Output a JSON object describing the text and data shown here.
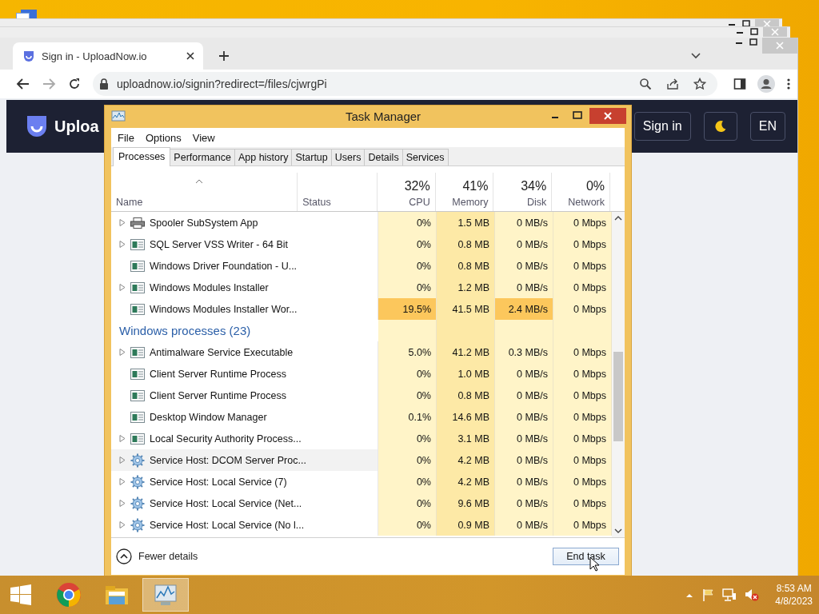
{
  "browser": {
    "tab": {
      "title": "Sign in - UploadNow.io"
    },
    "url": "uploadnow.io/signin?redirect=/files/cjwrgPi",
    "page": {
      "brand": "Uploa",
      "sign_in": "Sign in",
      "language": "EN"
    }
  },
  "task_manager": {
    "title": "Task Manager",
    "menu": [
      "File",
      "Options",
      "View"
    ],
    "tabs": [
      {
        "label": "Processes",
        "selected": true
      },
      {
        "label": "Performance",
        "selected": false
      },
      {
        "label": "App history",
        "selected": false
      },
      {
        "label": "Startup",
        "selected": false
      },
      {
        "label": "Users",
        "selected": false
      },
      {
        "label": "Details",
        "selected": false
      },
      {
        "label": "Services",
        "selected": false
      }
    ],
    "columns": [
      {
        "label": "Name"
      },
      {
        "label": "Status"
      },
      {
        "usage": "32%",
        "label": "CPU"
      },
      {
        "usage": "41%",
        "label": "Memory"
      },
      {
        "usage": "34%",
        "label": "Disk"
      },
      {
        "usage": "0%",
        "label": "Network"
      }
    ],
    "rows": [
      {
        "kind": "printer",
        "name": "Spooler SubSystem App",
        "expandable": true,
        "selected": false,
        "cells": [
          {
            "value": "0%",
            "hot": false
          },
          {
            "value": "1.5 MB",
            "hot": false
          },
          {
            "value": "0 MB/s",
            "hot": false
          },
          {
            "value": "0 Mbps",
            "hot": false
          }
        ]
      },
      {
        "kind": "app",
        "name": "SQL Server VSS Writer - 64 Bit",
        "expandable": true,
        "selected": false,
        "cells": [
          {
            "value": "0%",
            "hot": false
          },
          {
            "value": "0.8 MB",
            "hot": false
          },
          {
            "value": "0 MB/s",
            "hot": false
          },
          {
            "value": "0 Mbps",
            "hot": false
          }
        ]
      },
      {
        "kind": "app",
        "name": "Windows Driver Foundation - U...",
        "expandable": false,
        "selected": false,
        "cells": [
          {
            "value": "0%",
            "hot": false
          },
          {
            "value": "0.8 MB",
            "hot": false
          },
          {
            "value": "0 MB/s",
            "hot": false
          },
          {
            "value": "0 Mbps",
            "hot": false
          }
        ]
      },
      {
        "kind": "app",
        "name": "Windows Modules Installer",
        "expandable": true,
        "selected": false,
        "cells": [
          {
            "value": "0%",
            "hot": false
          },
          {
            "value": "1.2 MB",
            "hot": false
          },
          {
            "value": "0 MB/s",
            "hot": false
          },
          {
            "value": "0 Mbps",
            "hot": false
          }
        ]
      },
      {
        "kind": "app",
        "name": "Windows Modules Installer Wor...",
        "expandable": false,
        "selected": false,
        "cells": [
          {
            "value": "19.5%",
            "hot": true
          },
          {
            "value": "41.5 MB",
            "hot": false
          },
          {
            "value": "2.4 MB/s",
            "hot": true
          },
          {
            "value": "0 Mbps",
            "hot": false
          }
        ]
      },
      {
        "kind": "group",
        "name": "Windows processes (23)"
      },
      {
        "kind": "app",
        "name": "Antimalware Service Executable",
        "expandable": true,
        "selected": false,
        "cells": [
          {
            "value": "5.0%",
            "hot": false
          },
          {
            "value": "41.2 MB",
            "hot": false
          },
          {
            "value": "0.3 MB/s",
            "hot": false
          },
          {
            "value": "0 Mbps",
            "hot": false
          }
        ]
      },
      {
        "kind": "app",
        "name": "Client Server Runtime Process",
        "expandable": false,
        "selected": false,
        "cells": [
          {
            "value": "0%",
            "hot": false
          },
          {
            "value": "1.0 MB",
            "hot": false
          },
          {
            "value": "0 MB/s",
            "hot": false
          },
          {
            "value": "0 Mbps",
            "hot": false
          }
        ]
      },
      {
        "kind": "app",
        "name": "Client Server Runtime Process",
        "expandable": false,
        "selected": false,
        "cells": [
          {
            "value": "0%",
            "hot": false
          },
          {
            "value": "0.8 MB",
            "hot": false
          },
          {
            "value": "0 MB/s",
            "hot": false
          },
          {
            "value": "0 Mbps",
            "hot": false
          }
        ]
      },
      {
        "kind": "app",
        "name": "Desktop Window Manager",
        "expandable": false,
        "selected": false,
        "cells": [
          {
            "value": "0.1%",
            "hot": false
          },
          {
            "value": "14.6 MB",
            "hot": false
          },
          {
            "value": "0 MB/s",
            "hot": false
          },
          {
            "value": "0 Mbps",
            "hot": false
          }
        ]
      },
      {
        "kind": "app",
        "name": "Local Security Authority Process...",
        "expandable": true,
        "selected": false,
        "cells": [
          {
            "value": "0%",
            "hot": false
          },
          {
            "value": "3.1 MB",
            "hot": false
          },
          {
            "value": "0 MB/s",
            "hot": false
          },
          {
            "value": "0 Mbps",
            "hot": false
          }
        ]
      },
      {
        "kind": "service",
        "name": "Service Host: DCOM Server Proc...",
        "expandable": true,
        "selected": true,
        "cells": [
          {
            "value": "0%",
            "hot": false
          },
          {
            "value": "4.2 MB",
            "hot": false
          },
          {
            "value": "0 MB/s",
            "hot": false
          },
          {
            "value": "0 Mbps",
            "hot": false
          }
        ]
      },
      {
        "kind": "service",
        "name": "Service Host: Local Service (7)",
        "expandable": true,
        "selected": false,
        "cells": [
          {
            "value": "0%",
            "hot": false
          },
          {
            "value": "4.2 MB",
            "hot": false
          },
          {
            "value": "0 MB/s",
            "hot": false
          },
          {
            "value": "0 Mbps",
            "hot": false
          }
        ]
      },
      {
        "kind": "service",
        "name": "Service Host: Local Service (Net...",
        "expandable": true,
        "selected": false,
        "cells": [
          {
            "value": "0%",
            "hot": false
          },
          {
            "value": "9.6 MB",
            "hot": false
          },
          {
            "value": "0 MB/s",
            "hot": false
          },
          {
            "value": "0 Mbps",
            "hot": false
          }
        ]
      },
      {
        "kind": "service",
        "name": "Service Host: Local Service (No l...",
        "expandable": true,
        "selected": false,
        "cells": [
          {
            "value": "0%",
            "hot": false
          },
          {
            "value": "0.9 MB",
            "hot": false
          },
          {
            "value": "0 MB/s",
            "hot": false
          },
          {
            "value": "0 Mbps",
            "hot": false
          }
        ]
      }
    ],
    "footer": {
      "details": "Fewer details",
      "end_task": "End task"
    }
  },
  "taskbar": {
    "apps": [
      {
        "kind": "chrome",
        "selected": false
      },
      {
        "kind": "explorer",
        "selected": false
      },
      {
        "kind": "taskmgr",
        "selected": true
      }
    ],
    "time": "8:53 AM",
    "date": "4/8/2023"
  }
}
